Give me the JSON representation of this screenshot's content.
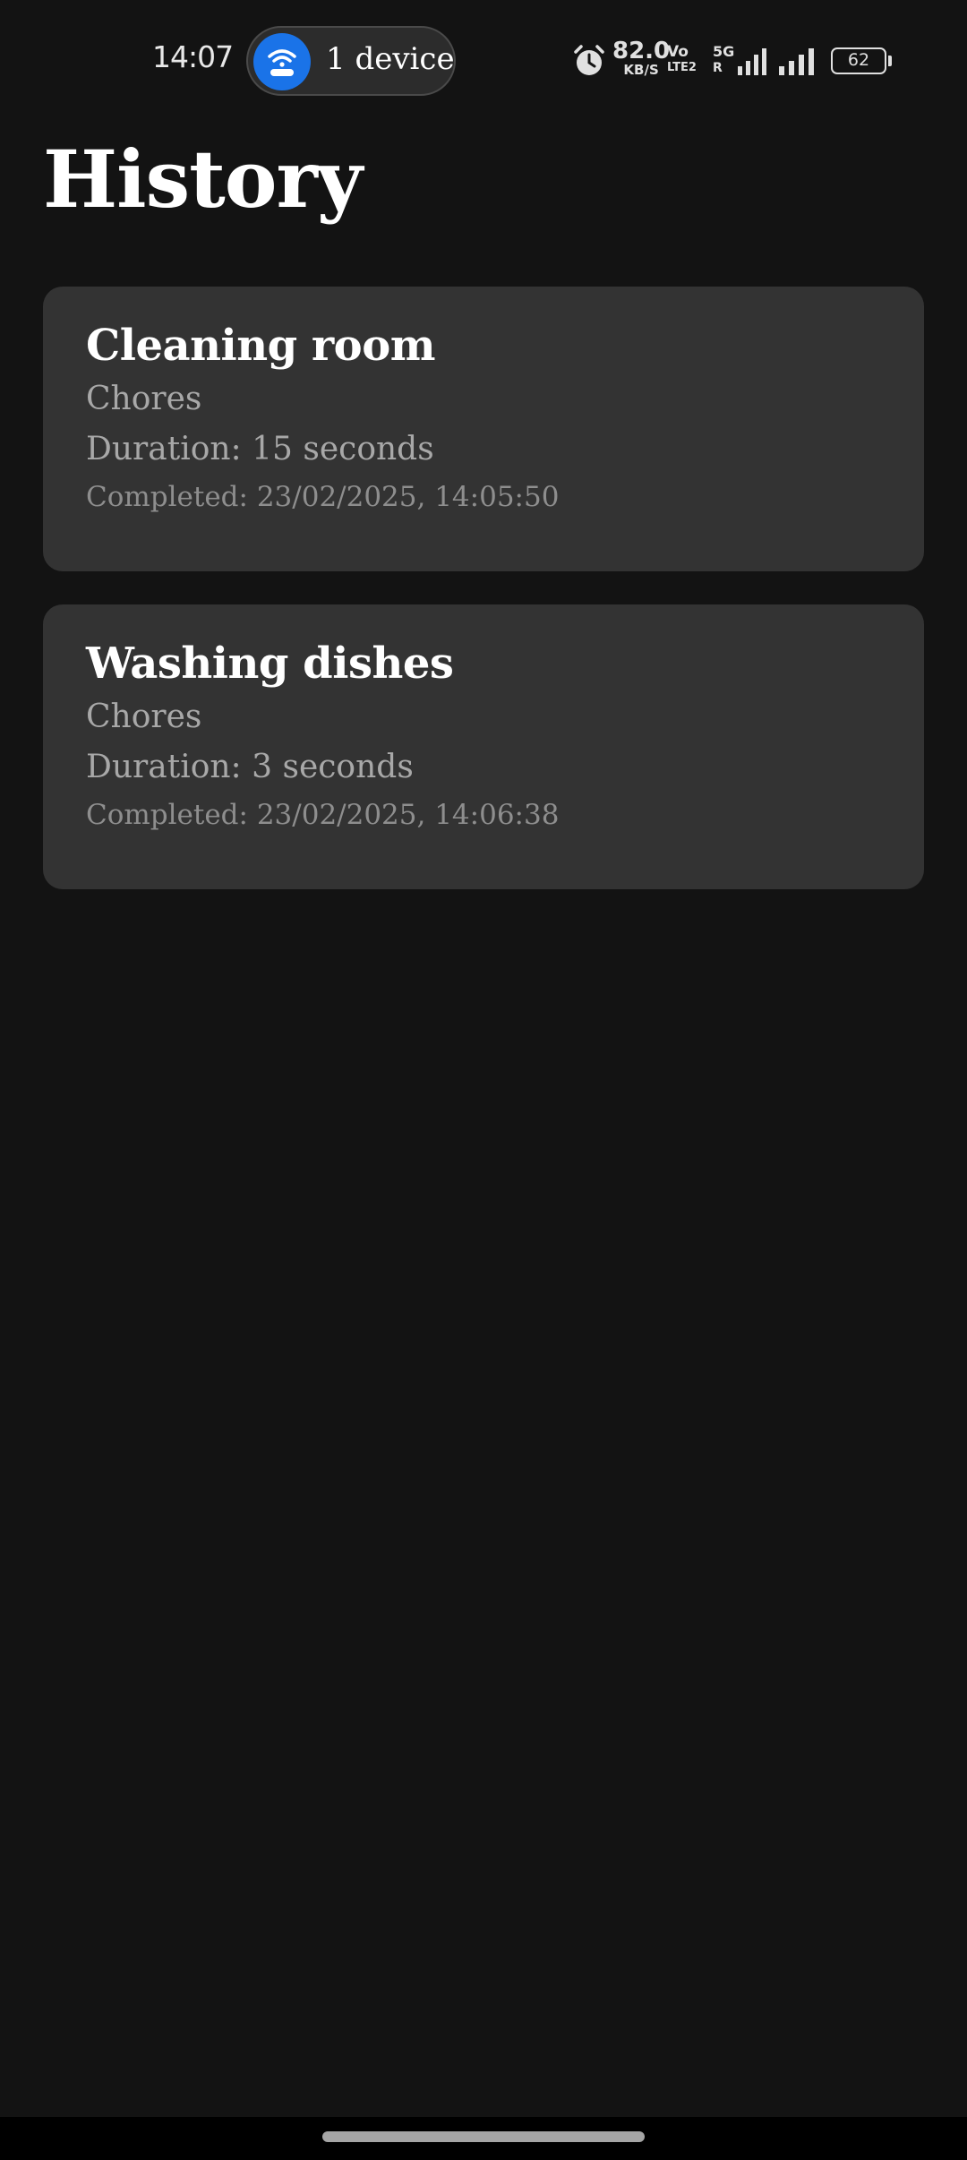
{
  "status_bar": {
    "time": "14:07",
    "hotspot_label": "1 device",
    "hotspot_icon": "wifi-router-icon",
    "alarm_icon": "alarm-icon",
    "net_speed_value": "82.0",
    "net_speed_unit": "KB/S",
    "volte_top": "Vo",
    "volte_sub": "LTE2",
    "network_type": "5G",
    "network_sub": "R",
    "battery_level": "62"
  },
  "page": {
    "title": "History"
  },
  "history": [
    {
      "title": "Cleaning room",
      "category": "Chores",
      "duration": "Duration: 15 seconds",
      "completed": "Completed: 23/02/2025, 14:05:50"
    },
    {
      "title": "Washing dishes",
      "category": "Chores",
      "duration": "Duration: 3 seconds",
      "completed": "Completed: 23/02/2025, 14:06:38"
    }
  ],
  "colors": {
    "background": "#131313",
    "card": "#333333",
    "hotspot_accent": "#1a73e8",
    "secondary_text": "#a8a8a8"
  }
}
